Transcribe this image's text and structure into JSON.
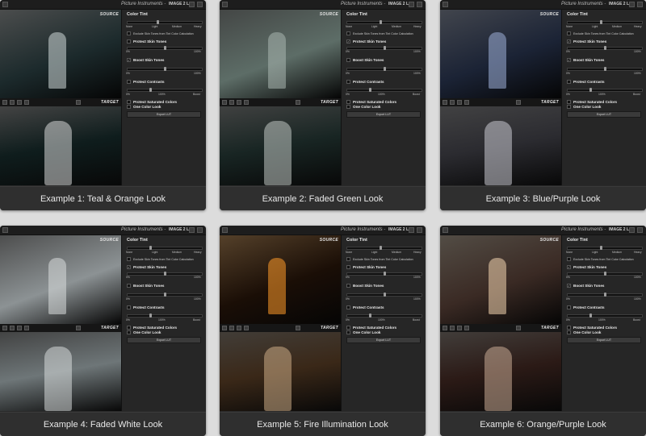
{
  "app": {
    "brand": "Picture Instruments",
    "separator": "-",
    "product": "IMAGE 2 LUT"
  },
  "panel": {
    "color_tint": "Color Tint",
    "scale": [
      "None",
      "Light",
      "Medium",
      "Heavy"
    ],
    "exclude_skin": "Exclude Skin Tones from Tint Color Calculation",
    "protect_skin": "Protect Skin Tones",
    "boost_skin": "Boost Skin Tones",
    "protect_contrasts": "Protect Contrasts",
    "protect_saturated": "Protect Saturated Colors",
    "one_color_look": "One Color Look",
    "export_lut": "Export LUT",
    "pct_0": "0%",
    "pct_100": "100%",
    "boost": "Boost"
  },
  "labels": {
    "source": "SOURCE",
    "target": "TARGET"
  },
  "examples": [
    {
      "caption": "Example 1: Teal & Orange Look",
      "tint": 0.4,
      "protect_skin": 0.5,
      "boost_skin": 0.5,
      "contrast": 0.3,
      "chk_protect_skin": false,
      "chk_boost_skin": true,
      "chk_protect_contrasts": false,
      "src_bg": "#1c2a2c",
      "src_accent": "#cfd8d8",
      "tgt_bg": "#0f1d1d",
      "tgt_accent": "#e8e8e8"
    },
    {
      "caption": "Example 2: Faded Green Look",
      "tint": 0.45,
      "protect_skin": 0.5,
      "boost_skin": 0.5,
      "contrast": 0.3,
      "chk_protect_skin": true,
      "chk_boost_skin": false,
      "chk_protect_contrasts": false,
      "src_bg": "#5d6d67",
      "src_accent": "#a9b6b0",
      "tgt_bg": "#182523",
      "tgt_accent": "#cfd6d2"
    },
    {
      "caption": "Example 3: Blue/Purple Look",
      "tint": 0.45,
      "protect_skin": 0.5,
      "boost_skin": 0.5,
      "contrast": 0.3,
      "chk_protect_skin": true,
      "chk_boost_skin": true,
      "chk_protect_contrasts": false,
      "src_bg": "#1b2335",
      "src_accent": "#9fb1d8",
      "tgt_bg": "#2b2b30",
      "tgt_accent": "#d8d8e0"
    },
    {
      "caption": "Example 4: Faded White Look",
      "tint": 0.3,
      "protect_skin": 0.5,
      "boost_skin": 0.5,
      "contrast": 0.3,
      "chk_protect_skin": true,
      "chk_boost_skin": false,
      "chk_protect_contrasts": false,
      "src_bg": "#8c9294",
      "src_accent": "#d9dcdc",
      "tgt_bg": "#6e7678",
      "tgt_accent": "#e2e6e6"
    },
    {
      "caption": "Example 5: Fire Illumination Look",
      "tint": 0.45,
      "protect_skin": 0.5,
      "boost_skin": 0.5,
      "contrast": 0.3,
      "chk_protect_skin": false,
      "chk_boost_skin": false,
      "chk_protect_contrasts": false,
      "src_bg": "#1a0e06",
      "src_accent": "#ff9a2a",
      "tgt_bg": "#3a2818",
      "tgt_accent": "#d9b890"
    },
    {
      "caption": "Example 6: Orange/Purple Look",
      "tint": 0.45,
      "protect_skin": 0.5,
      "boost_skin": 0.5,
      "contrast": 0.3,
      "chk_protect_skin": true,
      "chk_boost_skin": true,
      "chk_protect_contrasts": false,
      "src_bg": "#3a2a24",
      "src_accent": "#f4d6b0",
      "tgt_bg": "#2b1a16",
      "tgt_accent": "#d8b8a0"
    }
  ]
}
